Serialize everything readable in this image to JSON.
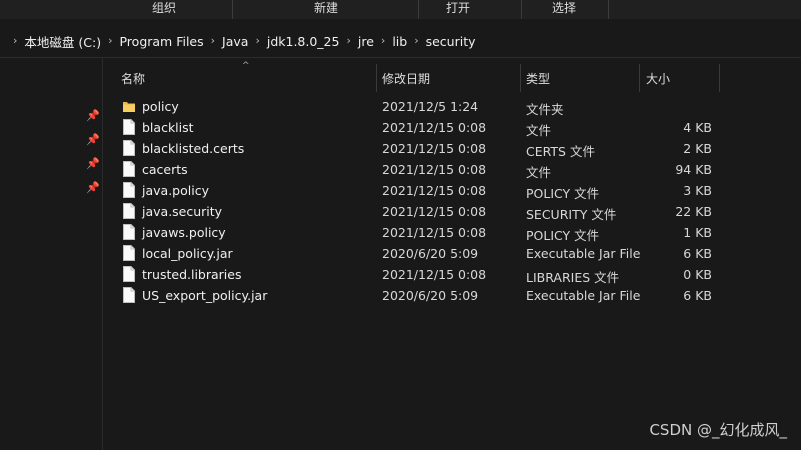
{
  "ribbon": {
    "groups": [
      "组织",
      "新建",
      "打开",
      "选择"
    ]
  },
  "breadcrumb": {
    "items": [
      "本地磁盘 (C:)",
      "Program Files",
      "Java",
      "jdk1.8.0_25",
      "jre",
      "lib",
      "security"
    ]
  },
  "columns": {
    "name": "名称",
    "modified": "修改日期",
    "type": "类型",
    "size": "大小"
  },
  "files": [
    {
      "name": "policy",
      "modified": "2021/12/5 1:24",
      "type": "文件夹",
      "size": "",
      "icon": "folder-icon"
    },
    {
      "name": "blacklist",
      "modified": "2021/12/15 0:08",
      "type": "文件",
      "size": "4 KB",
      "icon": "file-icon"
    },
    {
      "name": "blacklisted.certs",
      "modified": "2021/12/15 0:08",
      "type": "CERTS 文件",
      "size": "2 KB",
      "icon": "file-icon"
    },
    {
      "name": "cacerts",
      "modified": "2021/12/15 0:08",
      "type": "文件",
      "size": "94 KB",
      "icon": "file-icon"
    },
    {
      "name": "java.policy",
      "modified": "2021/12/15 0:08",
      "type": "POLICY 文件",
      "size": "3 KB",
      "icon": "file-icon"
    },
    {
      "name": "java.security",
      "modified": "2021/12/15 0:08",
      "type": "SECURITY 文件",
      "size": "22 KB",
      "icon": "file-icon"
    },
    {
      "name": "javaws.policy",
      "modified": "2021/12/15 0:08",
      "type": "POLICY 文件",
      "size": "1 KB",
      "icon": "file-icon"
    },
    {
      "name": "local_policy.jar",
      "modified": "2020/6/20 5:09",
      "type": "Executable Jar File",
      "size": "6 KB",
      "icon": "file-icon"
    },
    {
      "name": "trusted.libraries",
      "modified": "2021/12/15 0:08",
      "type": "LIBRARIES 文件",
      "size": "0 KB",
      "icon": "file-icon"
    },
    {
      "name": "US_export_policy.jar",
      "modified": "2020/6/20 5:09",
      "type": "Executable Jar File",
      "size": "6 KB",
      "icon": "file-icon"
    }
  ],
  "watermark": "CSDN @_幻化成风_",
  "colors": {
    "background": "#191919",
    "folder": "#f0c24a",
    "file": "#ffffff"
  }
}
